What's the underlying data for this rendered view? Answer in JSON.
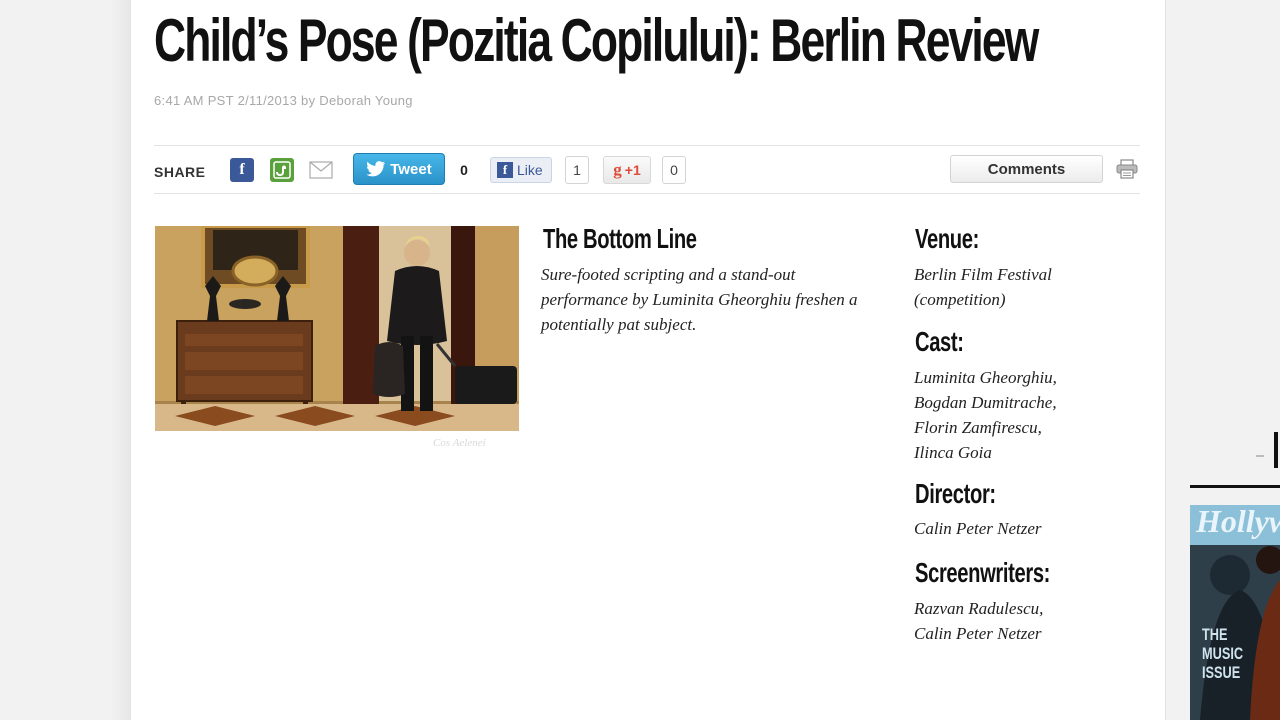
{
  "article": {
    "headline": "Child’s Pose (Pozitia Copilului): Berlin Review",
    "byline": "6:41 AM PST 2/11/2013 by Deborah Young"
  },
  "share_bar": {
    "label": "SHARE",
    "tweet_label": "Tweet",
    "tweet_count": "0",
    "like_label": "Like",
    "like_count": "1",
    "gplus_label": "+1",
    "gplus_count": "0",
    "comments_label": "Comments",
    "icons": [
      "facebook-icon",
      "stumbleupon-icon",
      "email-icon",
      "twitter-icon",
      "print-icon"
    ]
  },
  "photo": {
    "credit": "Cos Aelenei"
  },
  "bottom_line": {
    "heading": "The Bottom Line",
    "text": "Sure-footed scripting and a stand-out performance by Luminita Gheorghiu freshen a potentially pat subject."
  },
  "info": {
    "venue_label": "Venue:",
    "venue_lines": [
      "Berlin Film Festival",
      "(competition)"
    ],
    "cast_label": "Cast:",
    "cast_lines": [
      "Luminita Gheorghiu,",
      "Bogdan Dumitrache,",
      "Florin Zamfirescu,",
      "Ilinca Goia"
    ],
    "director_label": "Director:",
    "director_lines": [
      "Calin Peter Netzer"
    ],
    "screenwriters_label": "Screenwriters:",
    "screenwriters_lines": [
      "Razvan Radulescu,",
      "Calin Peter Netzer"
    ]
  },
  "sidebar": {
    "magazine_masthead": "Hollywood",
    "magazine_cover_line": "THE MUSIC ISSUE"
  },
  "colors": {
    "facebook": "#3b5998",
    "twitter": "#2a93c9",
    "stumbleupon": "#5aa03c",
    "gplus": "#dd4b39"
  }
}
